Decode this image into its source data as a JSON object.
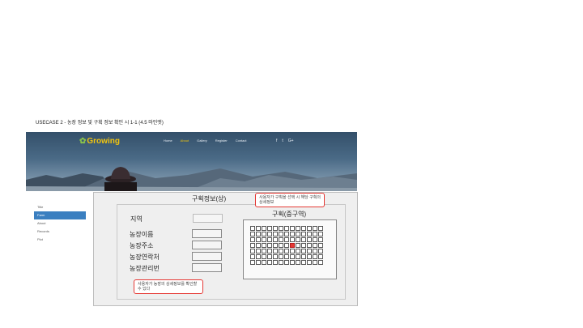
{
  "usecase_title": "USECASE 2 - 농장 정보 및 구획 정보 확인 시 1-1 (4.5 마인엣)",
  "header": {
    "brand": "Growing",
    "nav": [
      "Home",
      "About",
      "Gallery",
      "Register",
      "Contact"
    ],
    "active_nav": "About",
    "social": [
      "f",
      "t",
      "G+"
    ]
  },
  "sidebar": {
    "items": [
      "Title",
      "Farm",
      "About",
      "Records",
      "Plot"
    ],
    "active_index": 1
  },
  "panel": {
    "title": "구획정보(상)",
    "fields": [
      {
        "label": "지역",
        "value": ""
      },
      {
        "label": "농장이름",
        "value": ""
      },
      {
        "label": "농장주소",
        "value": ""
      },
      {
        "label": "농장연락처",
        "value": ""
      },
      {
        "label": "농장관리번",
        "value": ""
      }
    ],
    "grid_title": "구획(중구역)",
    "grid": {
      "columns": 13,
      "rows": 7,
      "selected": [
        [
          3,
          7
        ]
      ]
    }
  },
  "notes": {
    "top": "사용자가 구획을 선택 시 해당 구획의 상세정보",
    "bottom": "사용자가 농장의 상세정보를 확인할 수 있다"
  },
  "colors": {
    "accent": "#3a7fc0",
    "brand": "#f1c40f",
    "highlight": "#e53935"
  }
}
